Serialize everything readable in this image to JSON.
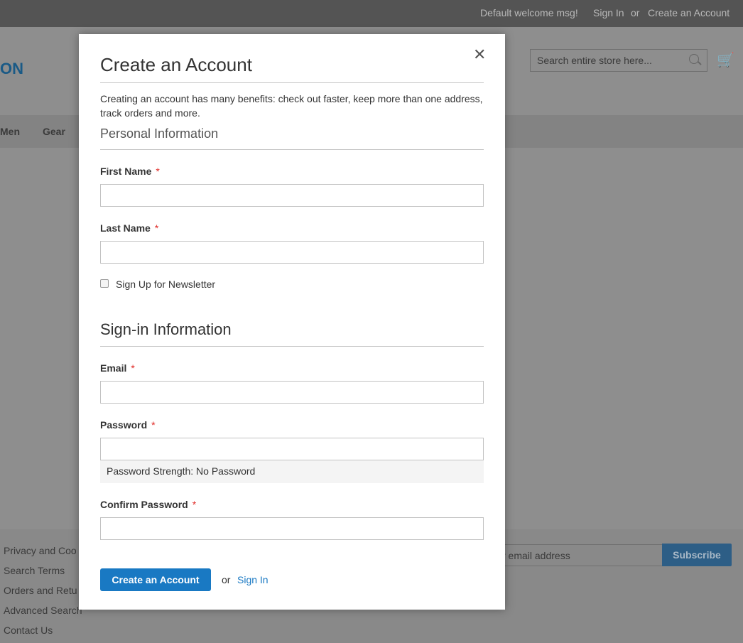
{
  "topbar": {
    "welcome": "Default welcome msg!",
    "sign_in": "Sign In",
    "or": "or",
    "create_account": "Create an Account"
  },
  "header": {
    "logo_fragment": "ON",
    "search_placeholder": "Search entire store here...",
    "search_icon": "search-icon",
    "cart_icon": "cart-icon"
  },
  "nav": {
    "items": [
      "Men",
      "Gear"
    ]
  },
  "footer": {
    "links": [
      "Privacy and Coo",
      "Search Terms",
      "Orders and Retu",
      "Advanced Search",
      "Contact Us"
    ],
    "newsletter_placeholder": "r email address",
    "subscribe": "Subscribe"
  },
  "modal": {
    "close_icon": "close-icon",
    "title": "Create an Account",
    "intro": "Creating an account has many benefits: check out faster, keep more than one address, track orders and more.",
    "personal_heading": "Personal Information",
    "first_name": "First Name",
    "last_name": "Last Name",
    "required_mark": "*",
    "newsletter": "Sign Up for Newsletter",
    "signin_heading": "Sign-in Information",
    "email": "Email",
    "password": "Password",
    "password_strength": "Password Strength: No Password",
    "confirm_password": "Confirm Password",
    "submit": "Create an Account",
    "or": "or",
    "sign_in": "Sign In"
  },
  "colors": {
    "primary": "#1979c3",
    "required": "#e02b27"
  }
}
